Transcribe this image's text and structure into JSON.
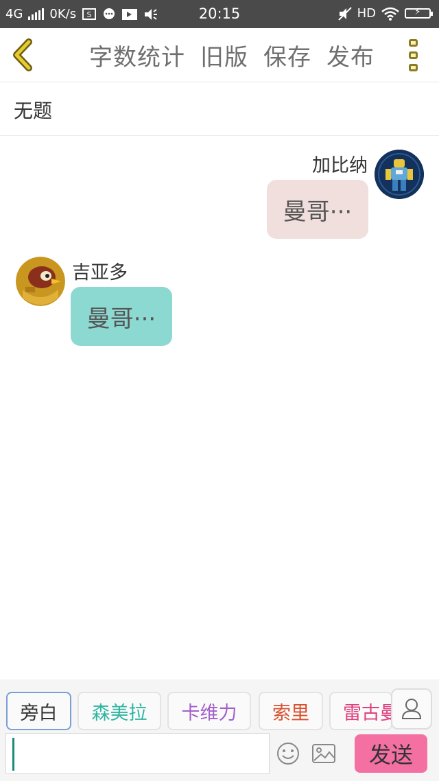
{
  "status_bar": {
    "network": "4G",
    "speed": "0K/s",
    "time": "20:15",
    "hd": "HD"
  },
  "toolbar": {
    "back_icon": "chevron-left-icon",
    "actions": [
      "字数统计",
      "旧版",
      "保存",
      "发布"
    ],
    "more_icon": "more-vertical-icon"
  },
  "title": {
    "text": "无题"
  },
  "messages": [
    {
      "side": "right",
      "name": "加比纳",
      "text": "曼哥···",
      "bubble_color": "#f0dfdd",
      "avatar_icon": "robot-avatar"
    },
    {
      "side": "left",
      "name": "吉亚多",
      "text": "曼哥···",
      "bubble_color": "#8cd9d2",
      "avatar_icon": "bird-avatar"
    }
  ],
  "characters": [
    {
      "label": "旁白",
      "color": "#333333",
      "selected": true
    },
    {
      "label": "森美拉",
      "color": "#2fb5a2",
      "selected": false
    },
    {
      "label": "卡维力",
      "color": "#a35fc9",
      "selected": false
    },
    {
      "label": "索里",
      "color": "#d9502f",
      "selected": false
    },
    {
      "label": "雷古曼",
      "color": "#e0407e",
      "selected": false
    }
  ],
  "input": {
    "value": "",
    "send_label": "发送"
  },
  "colors": {
    "accent": "#f46fa2",
    "back_icon": "#e6cc2e"
  }
}
